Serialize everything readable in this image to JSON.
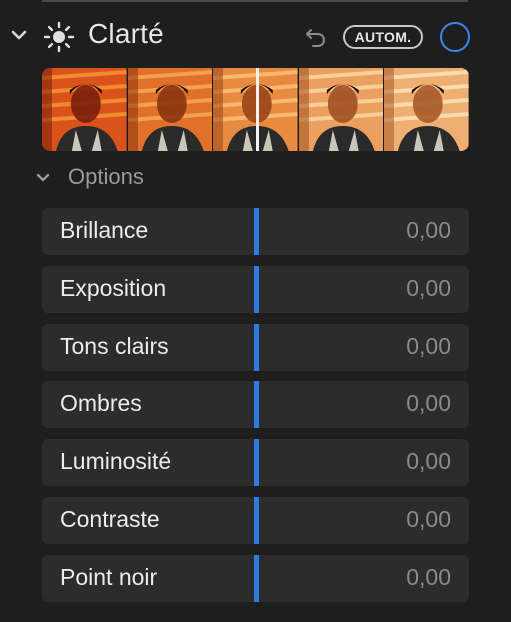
{
  "header": {
    "title": "Clarté",
    "collapse_icon": "chevron-down-icon",
    "adjustment_icon": "sun-icon",
    "revert_icon": "undo-icon",
    "auto_label": "AUTOM.",
    "toggle_icon": "circle-toggle-icon",
    "accent_color": "#3b86f0"
  },
  "preview": {
    "thumbnail_count": 5,
    "selected_index": 2
  },
  "options": {
    "label": "Options",
    "expanded": true,
    "sliders": [
      {
        "label": "Brillance",
        "value": "0,00",
        "position": 0.5
      },
      {
        "label": "Exposition",
        "value": "0,00",
        "position": 0.5
      },
      {
        "label": "Tons clairs",
        "value": "0,00",
        "position": 0.5
      },
      {
        "label": "Ombres",
        "value": "0,00",
        "position": 0.5
      },
      {
        "label": "Luminosité",
        "value": "0,00",
        "position": 0.5
      },
      {
        "label": "Contraste",
        "value": "0,00",
        "position": 0.5
      },
      {
        "label": "Point noir",
        "value": "0,00",
        "position": 0.5
      }
    ]
  },
  "colors": {
    "panel_background": "#1e1e1e",
    "slider_background": "#2c2c2c",
    "slider_indicator": "#2f7be6",
    "muted_text": "#9a9a9a"
  }
}
